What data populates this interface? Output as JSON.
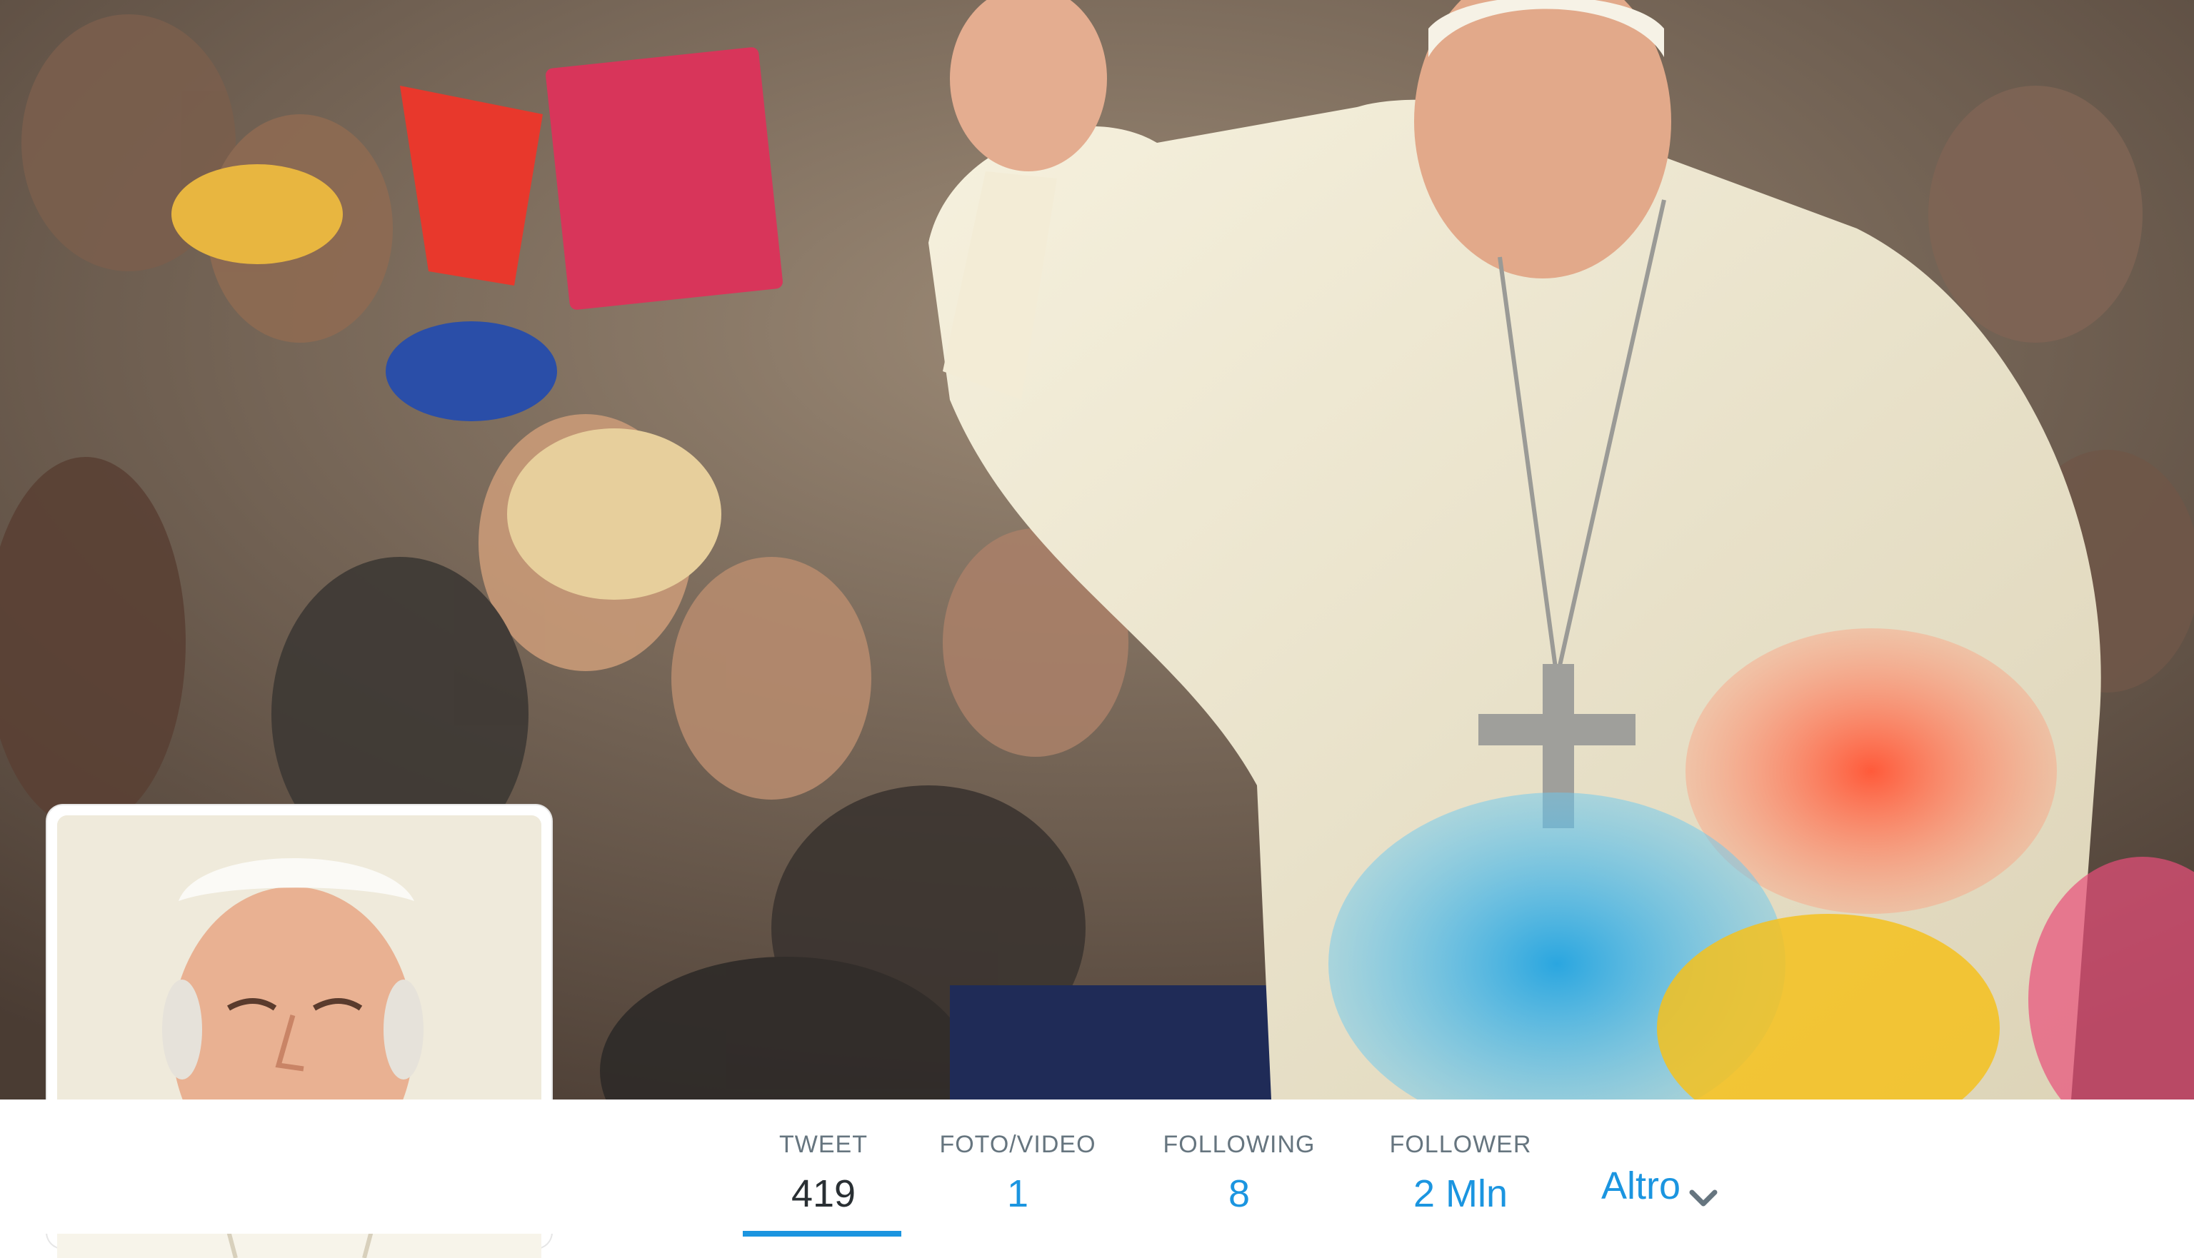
{
  "profile": {
    "header_image": "header-photo",
    "avatar_image": "profile-avatar"
  },
  "stats": [
    {
      "label": "TWEET",
      "value": "419"
    },
    {
      "label": "FOTO/VIDEO",
      "value": "1"
    },
    {
      "label": "FOLLOWING",
      "value": "8"
    },
    {
      "label": "FOLLOWER",
      "value": "2 Mln"
    }
  ],
  "more_menu": {
    "label": "Altro",
    "icon": "chevron-down-icon"
  },
  "colors": {
    "link": "#1b95e0",
    "label": "#66757f",
    "active_value": "#292f33"
  }
}
